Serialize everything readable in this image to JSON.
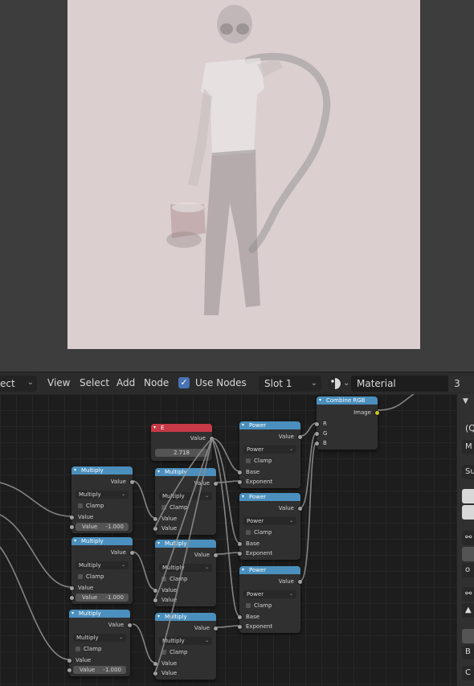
{
  "header": {
    "mode_label": "ect",
    "menu": [
      "View",
      "Select",
      "Add",
      "Node"
    ],
    "use_nodes_label": "Use Nodes",
    "slot_label": "Slot 1",
    "material_name": "Material",
    "user_count": "3"
  },
  "nodes": {
    "e": {
      "title": "E",
      "output": "Value",
      "value": "2.718"
    },
    "combine": {
      "title": "Combine RGB",
      "output": "Image",
      "inputs": [
        "R",
        "G",
        "B"
      ]
    },
    "multiply_title": "Multiply",
    "power_title": "Power",
    "value_label": "Value",
    "clamp_label": "Clamp",
    "base_label": "Base",
    "exponent_label": "Exponent",
    "multiply_op": "Multiply",
    "power_op": "Power",
    "neg_one": "-1.000"
  },
  "props": {
    "letters": [
      "(Q",
      "M",
      "Su",
      "o",
      "B",
      "C"
    ]
  },
  "colors": {
    "utility_header": "#4a8fbd",
    "input_header": "#c63a47",
    "checkbox_accent": "#4772b3",
    "render_background": "#dccfd0"
  }
}
